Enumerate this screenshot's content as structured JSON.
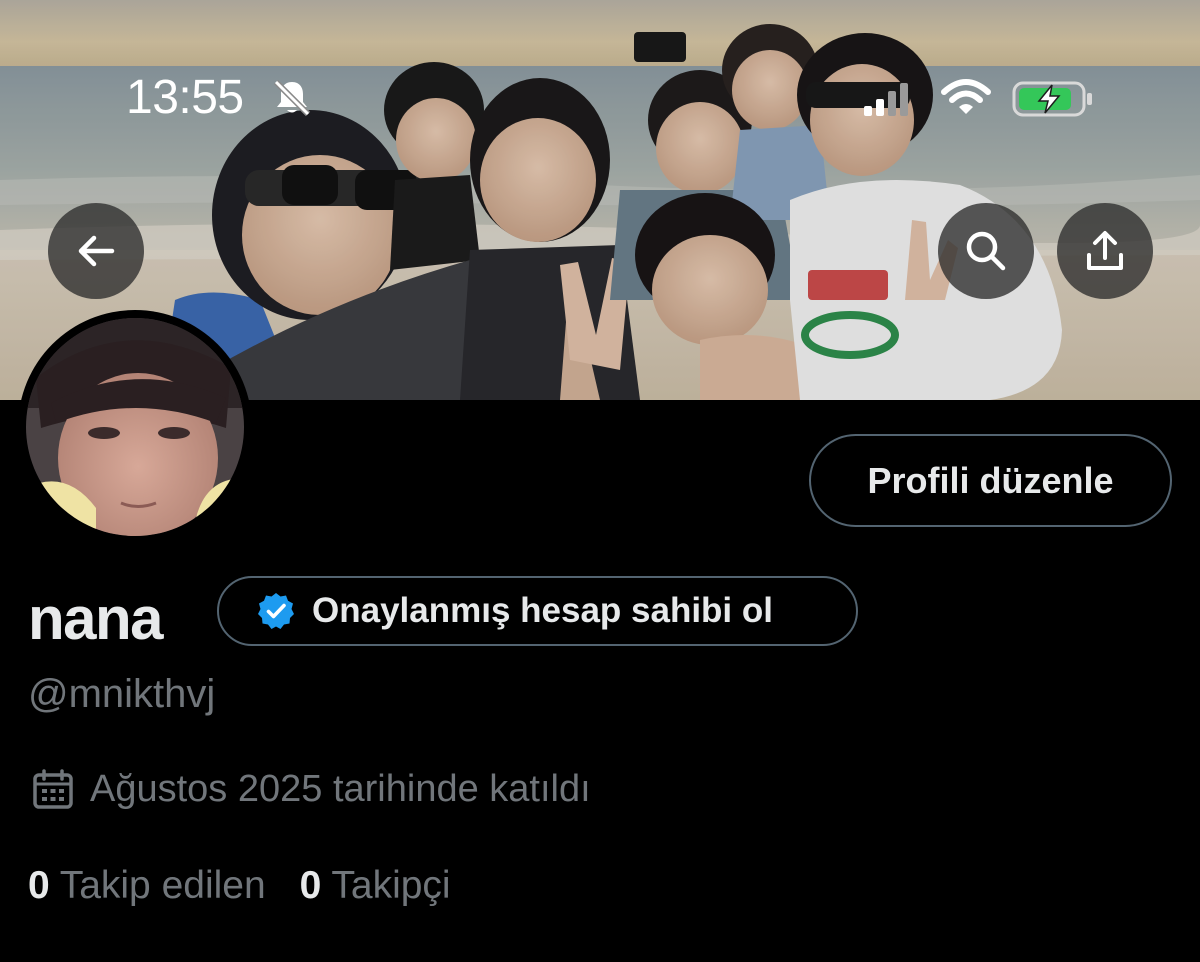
{
  "status_bar": {
    "time": "13:55",
    "icons": [
      "bell-slash-icon",
      "cellular-signal-icon",
      "wifi-icon",
      "battery-charging-icon"
    ]
  },
  "header": {
    "icons": [
      "arrow-left-icon",
      "search-icon",
      "share-upload-icon"
    ]
  },
  "profile": {
    "edit_button_label": "Profili düzenle",
    "display_name": "nana",
    "verify_cta": "Onaylanmış hesap sahibi ol",
    "handle": "@mnikthvj",
    "joined": "Ağustos 2025 tarihinde katıldı"
  },
  "stats": {
    "following_count": "0",
    "following_label": "Takip edilen",
    "followers_count": "0",
    "followers_label": "Takipçi"
  },
  "colors": {
    "background": "#000000",
    "text_primary": "#e7e9ea",
    "text_secondary": "#71767b",
    "border": "#536471",
    "verified_blue": "#1d9bf0",
    "battery_green": "#34c759"
  }
}
